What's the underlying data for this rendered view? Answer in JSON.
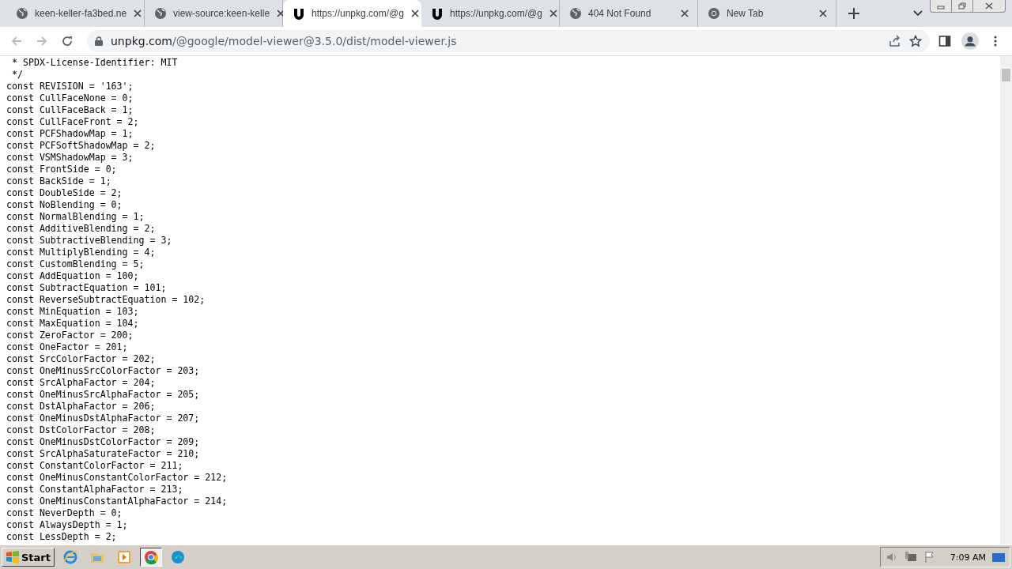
{
  "tabs": [
    {
      "title": "keen-keller-fa3bed.ne",
      "selected": false
    },
    {
      "title": "view-source:keen-kelle",
      "selected": false
    },
    {
      "title": "https://unpkg.com/@g",
      "selected": true
    },
    {
      "title": "https://unpkg.com/@g",
      "selected": false
    },
    {
      "title": "404 Not Found",
      "selected": false
    },
    {
      "title": "New Tab",
      "selected": false
    }
  ],
  "address": {
    "host": "unpkg.com",
    "path": "/@google/model-viewer@3.5.0/dist/model-viewer.js"
  },
  "code_lines": [
    " * SPDX-License-Identifier: MIT",
    " */",
    "const REVISION = '163';",
    "const CullFaceNone = 0;",
    "const CullFaceBack = 1;",
    "const CullFaceFront = 2;",
    "const PCFShadowMap = 1;",
    "const PCFSoftShadowMap = 2;",
    "const VSMShadowMap = 3;",
    "const FrontSide = 0;",
    "const BackSide = 1;",
    "const DoubleSide = 2;",
    "const NoBlending = 0;",
    "const NormalBlending = 1;",
    "const AdditiveBlending = 2;",
    "const SubtractiveBlending = 3;",
    "const MultiplyBlending = 4;",
    "const CustomBlending = 5;",
    "const AddEquation = 100;",
    "const SubtractEquation = 101;",
    "const ReverseSubtractEquation = 102;",
    "const MinEquation = 103;",
    "const MaxEquation = 104;",
    "const ZeroFactor = 200;",
    "const OneFactor = 201;",
    "const SrcColorFactor = 202;",
    "const OneMinusSrcColorFactor = 203;",
    "const SrcAlphaFactor = 204;",
    "const OneMinusSrcAlphaFactor = 205;",
    "const DstAlphaFactor = 206;",
    "const OneMinusDstAlphaFactor = 207;",
    "const DstColorFactor = 208;",
    "const OneMinusDstColorFactor = 209;",
    "const SrcAlphaSaturateFactor = 210;",
    "const ConstantColorFactor = 211;",
    "const OneMinusConstantColorFactor = 212;",
    "const ConstantAlphaFactor = 213;",
    "const OneMinusConstantAlphaFactor = 214;",
    "const NeverDepth = 0;",
    "const AlwaysDepth = 1;",
    "const LessDepth = 2;"
  ],
  "taskbar": {
    "start": "Start",
    "apps": [
      {
        "selected": false
      },
      {
        "selected": false
      },
      {
        "selected": false
      },
      {
        "selected": true
      },
      {
        "selected": false
      }
    ],
    "clock": "7:09 AM"
  }
}
